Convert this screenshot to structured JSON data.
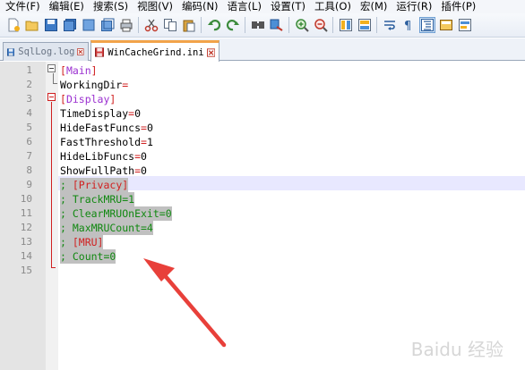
{
  "menu": [
    "文件(F)",
    "编辑(E)",
    "搜索(S)",
    "视图(V)",
    "编码(N)",
    "语言(L)",
    "设置(T)",
    "工具(O)",
    "宏(M)",
    "运行(R)",
    "插件(P)"
  ],
  "toolbar": {
    "buttons": [
      "new-file-icon",
      "open-file-icon",
      "save-icon",
      "save-all-icon",
      "close-icon",
      "close-all-icon",
      "print-icon",
      "cut-icon",
      "copy-icon",
      "paste-icon",
      "undo-icon",
      "redo-icon",
      "find-icon",
      "replace-icon",
      "zoom-in-icon",
      "zoom-out-icon",
      "sync-vertical-icon",
      "sync-horizontal-icon",
      "word-wrap-icon",
      "show-all-chars-icon",
      "indent-guide-icon",
      "udl-icon",
      "doc-map-icon"
    ]
  },
  "tabs": [
    {
      "label": "SqlLog.log",
      "active": false
    },
    {
      "label": "WinCacheGrind.ini",
      "active": true
    }
  ],
  "editor": {
    "lines": [
      {
        "num": "1",
        "text": "[Main]"
      },
      {
        "num": "2",
        "text": "WorkingDir="
      },
      {
        "num": "3",
        "text": "[Display]"
      },
      {
        "num": "4",
        "text": "TimeDisplay=0"
      },
      {
        "num": "5",
        "text": "HideFastFuncs=0"
      },
      {
        "num": "6",
        "text": "FastThreshold=1"
      },
      {
        "num": "7",
        "text": "HideLibFuncs=0"
      },
      {
        "num": "8",
        "text": "ShowFullPath=0"
      },
      {
        "num": "9",
        "text": "; [Privacy]"
      },
      {
        "num": "10",
        "text": "; TrackMRU=1"
      },
      {
        "num": "11",
        "text": "; ClearMRUOnExit=0"
      },
      {
        "num": "12",
        "text": "; MaxMRUCount=4"
      },
      {
        "num": "13",
        "text": "; [MRU]"
      },
      {
        "num": "14",
        "text": "; Count=0"
      },
      {
        "num": "15",
        "text": ""
      }
    ]
  },
  "watermark": "Baidu 经验",
  "colors": {
    "arrow": "#e8403a",
    "selection": "#c0c0c0",
    "comment": "#118811",
    "section": "#9b30d0"
  }
}
